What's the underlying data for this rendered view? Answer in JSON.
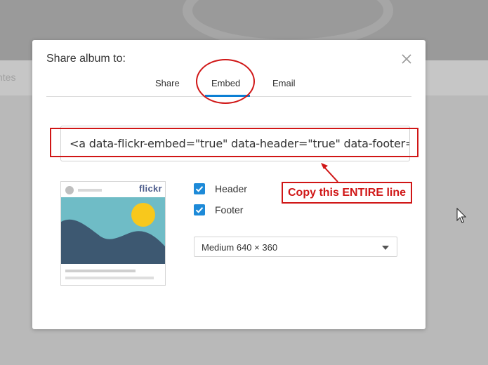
{
  "background": {
    "tab_fragment": "ntes"
  },
  "modal": {
    "title": "Share album to:",
    "close_icon": "close-icon",
    "tabs": [
      {
        "label": "Share",
        "active": false
      },
      {
        "label": "Embed",
        "active": true
      },
      {
        "label": "Email",
        "active": false
      }
    ],
    "embed_code": "<a data-flickr-embed=\"true\" data-header=\"true\" data-footer=\"true\" href=\"",
    "preview": {
      "logo_text": "flickr"
    },
    "options": {
      "header": {
        "label": "Header",
        "checked": true
      },
      "footer": {
        "label": "Footer",
        "checked": true
      }
    },
    "size_select": {
      "value": "Medium 640 × 360"
    }
  },
  "annotation": {
    "callout_text": "Copy this ENTIRE line",
    "color": "#d01616"
  },
  "colors": {
    "accent": "#1d8ad8",
    "tab_underline": "#0b7fd4"
  }
}
